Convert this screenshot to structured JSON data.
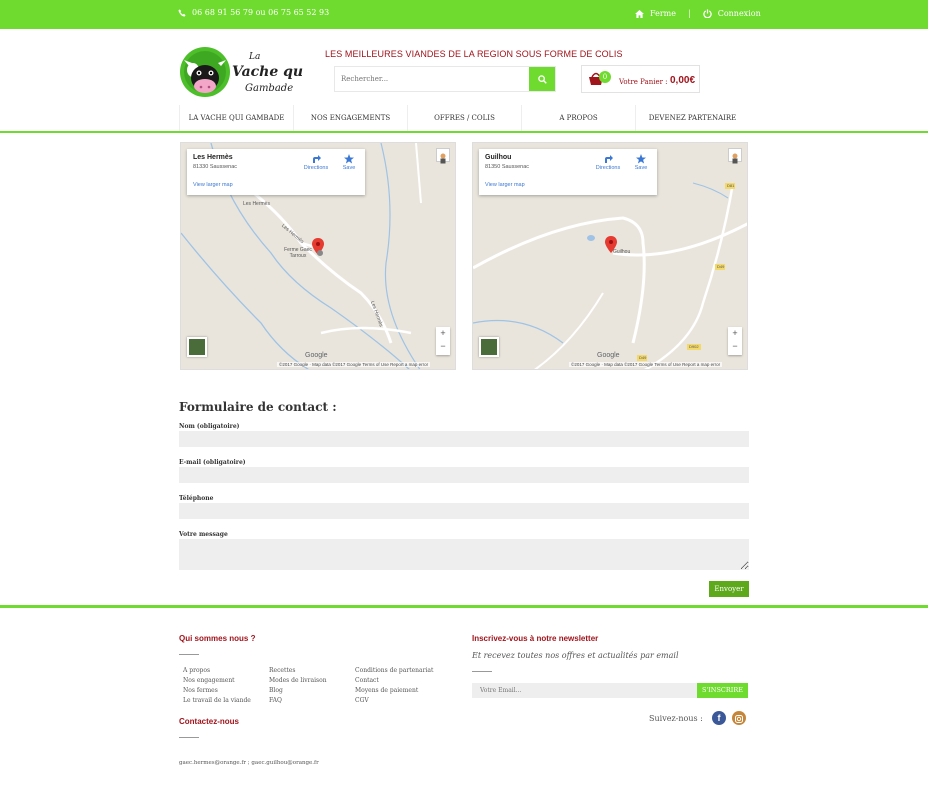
{
  "topbar": {
    "phone": "06 68 91 56 79 ou 06 75 65 52 93",
    "ferme": "Ferme",
    "connexion": "Connexion"
  },
  "brand": {
    "logo_text_1": "La",
    "logo_text_2": "Vache qui",
    "logo_text_3": "Gambade",
    "slogan": "LES MEILLEURES VIANDES DE LA REGION SOUS FORME DE COLIS"
  },
  "search": {
    "placeholder": "Rechercher..."
  },
  "cart": {
    "count": "0",
    "label": "Votre Panier :",
    "amount": "0,00€"
  },
  "nav": [
    {
      "label": "LA VACHE QUI GAMBADE"
    },
    {
      "label": "NOS ENGAGEMENTS"
    },
    {
      "label": "OFFRES / COLIS"
    },
    {
      "label": "A PROPOS"
    },
    {
      "label": "DEVENEZ PARTENAIRE"
    }
  ],
  "maps": [
    {
      "name": "Les Hermès",
      "address": "81330 Saussenac",
      "larger": "View larger map",
      "directions": "Directions",
      "save": "Save",
      "places": [
        "Les Hermès",
        "Ferme Gaec Tarroux",
        "Les Hermès",
        "Les Hermès"
      ],
      "google": "Google",
      "footer": "©2017 Google · Map data ©2017 Google   Terms of Use   Report a map error"
    },
    {
      "name": "Guilhou",
      "address": "81350 Saussenac",
      "larger": "View larger map",
      "directions": "Directions",
      "save": "Save",
      "places": [
        "Guilhou",
        "D81",
        "D49",
        "D902",
        "D49"
      ],
      "google": "Google",
      "footer": "©2017 Google · Map data ©2017 Google   Terms of Use   Report a map error"
    }
  ],
  "contact_form": {
    "title": "Formulaire de contact :",
    "name_label": "Nom (obligatoire)",
    "email_label": "E-mail (obligatoire)",
    "phone_label": "Téléphone",
    "message_label": "Votre message",
    "submit": "Envoyer"
  },
  "footer": {
    "about_title": "Qui sommes nous ?",
    "links_col1": [
      "A propos",
      "Nos engagement",
      "Nos fermes",
      "Le travail de la viande"
    ],
    "links_col2": [
      "Recettes",
      "Modes de livraison",
      "Blog",
      "FAQ"
    ],
    "links_col3": [
      "Conditions de partenariat",
      "Contact",
      "Moyens de paiement",
      "CGV"
    ],
    "contact_title": "Contactez-nous",
    "emails": "gaec.hermes@orange.fr ; gaec.guilhou@orange.fr",
    "newsletter_title": "Inscrivez-vous à notre newsletter",
    "newsletter_sub": "Et recevez toutes nos offres et actualités par email",
    "newsletter_placeholder": "Votre Email...",
    "newsletter_button": "S'INSCRIRE",
    "follow": "Suivez-nous :",
    "facebook": "f"
  },
  "colors": {
    "accent": "#6fdb2e",
    "brand_red": "#a0141c",
    "button_green": "#5da81b"
  }
}
